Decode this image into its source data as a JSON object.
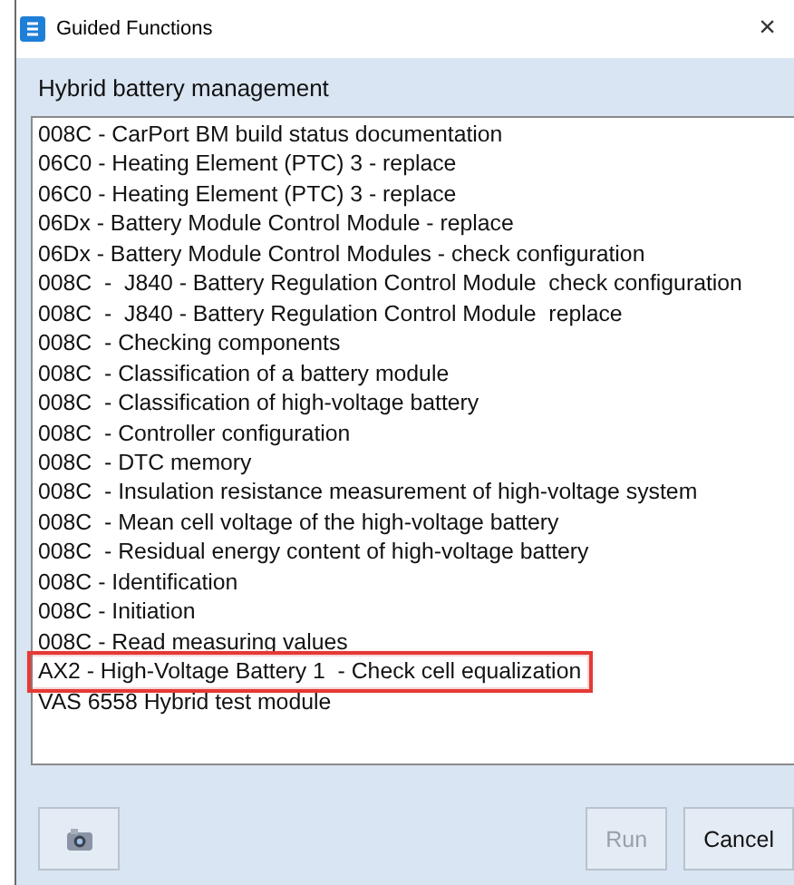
{
  "window": {
    "title": "Guided Functions",
    "close": "×"
  },
  "heading": "Hybrid battery management",
  "items": [
    {
      "label": "008C - CarPort BM build status documentation",
      "highlighted": false
    },
    {
      "label": "06C0 - Heating Element (PTC) 3 - replace",
      "highlighted": false
    },
    {
      "label": "06C0 - Heating Element (PTC) 3 - replace",
      "highlighted": false
    },
    {
      "label": "06Dx - Battery Module Control Module - replace",
      "highlighted": false
    },
    {
      "label": "06Dx - Battery Module Control Modules - check configuration",
      "highlighted": false
    },
    {
      "label": "008C  -  J840 - Battery Regulation Control Module  check configuration",
      "highlighted": false
    },
    {
      "label": "008C  -  J840 - Battery Regulation Control Module  replace",
      "highlighted": false
    },
    {
      "label": "008C  - Checking components",
      "highlighted": false
    },
    {
      "label": "008C  - Classification of a battery module",
      "highlighted": false
    },
    {
      "label": "008C  - Classification of high-voltage battery",
      "highlighted": false
    },
    {
      "label": "008C  - Controller configuration",
      "highlighted": false
    },
    {
      "label": "008C  - DTC memory",
      "highlighted": false
    },
    {
      "label": "008C  - Insulation resistance measurement of high-voltage system",
      "highlighted": false
    },
    {
      "label": "008C  - Mean cell voltage of the high-voltage battery",
      "highlighted": false
    },
    {
      "label": "008C  - Residual energy content of high-voltage battery",
      "highlighted": false
    },
    {
      "label": "008C - Identification",
      "highlighted": false
    },
    {
      "label": "008C - Initiation",
      "highlighted": false
    },
    {
      "label": "008C - Read measuring values",
      "highlighted": false
    },
    {
      "label": "AX2 - High-Voltage Battery 1  - Check cell equalization",
      "highlighted": true
    },
    {
      "label": "VAS 6558 Hybrid test module",
      "highlighted": false
    }
  ],
  "buttons": [
    {
      "kind": "camera"
    },
    {
      "kind": "text",
      "label": "Run",
      "disabled": true
    },
    {
      "kind": "text",
      "label": "Cancel",
      "disabled": false
    }
  ]
}
